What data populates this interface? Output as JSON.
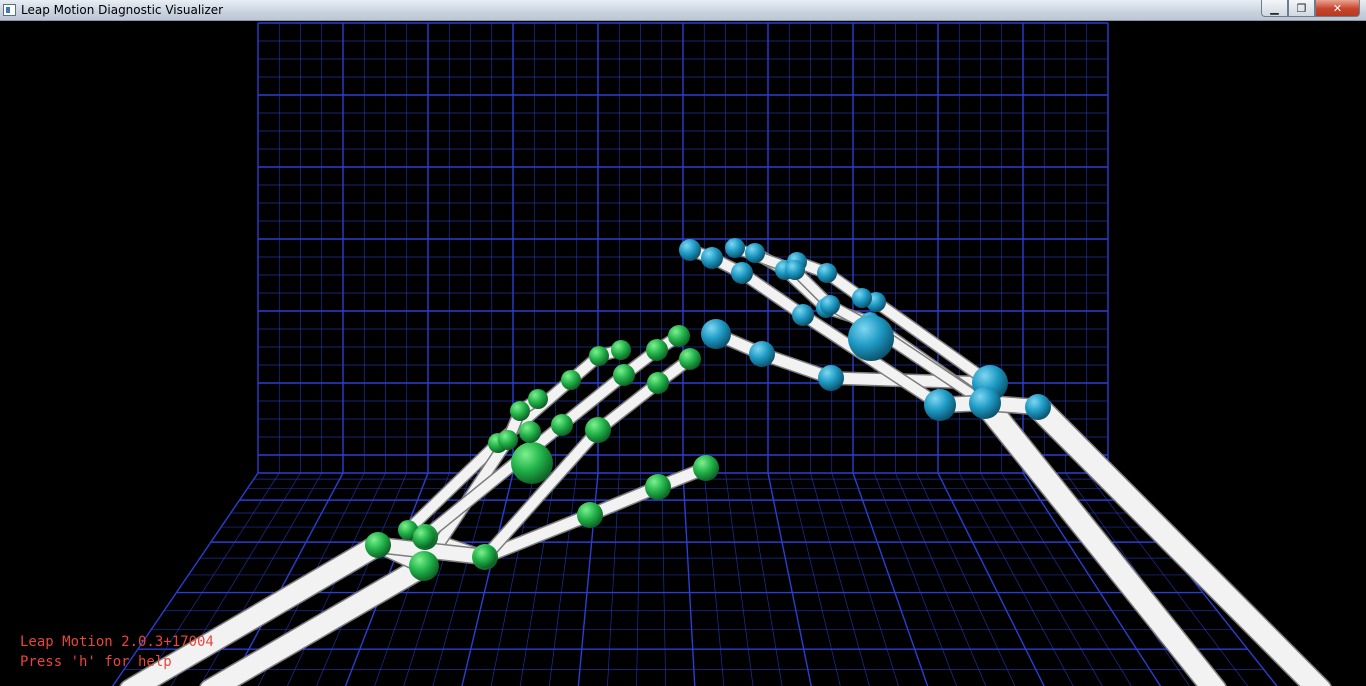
{
  "window": {
    "title": "Leap Motion Diagnostic Visualizer",
    "minimize": "▁",
    "maximize": "❐",
    "close": "✕"
  },
  "overlay": {
    "version": "Leap Motion 2.0.3+17004",
    "help": "Press 'h' for help"
  },
  "colors": {
    "grid": "#2a3fd0",
    "left_hand_joint": "#22b34a",
    "right_hand_joint": "#1e9ac4",
    "bone": "#e6e6e6",
    "overlay_text": "#e8473a"
  }
}
